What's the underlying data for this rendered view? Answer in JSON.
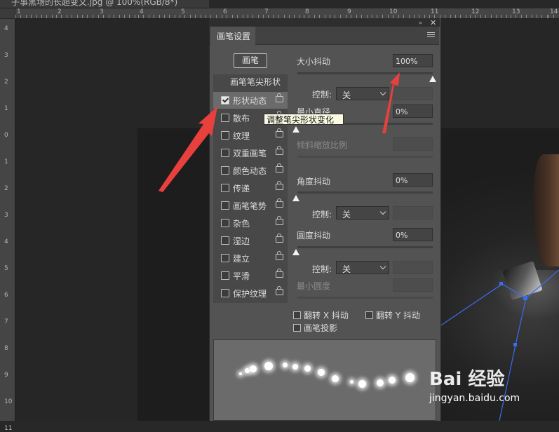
{
  "document_tab": {
    "title": "子事黑场的长超变文.jpg @ 100%(RGB/8*)"
  },
  "ruler": {
    "top_labels": [
      "1",
      "2",
      "3",
      "4",
      "5",
      "6",
      "7",
      "8",
      "9",
      "10",
      "11",
      "12",
      "13",
      "14"
    ],
    "left_labels": [
      "4",
      "3",
      "2",
      "1",
      "0",
      "1",
      "2",
      "3",
      "4",
      "5",
      "6",
      "7",
      "8",
      "9",
      "10",
      "11"
    ]
  },
  "panel": {
    "title": "画笔设置",
    "brush_button": "画笔",
    "tip_shape_label": "画笔笔尖形状",
    "categories": [
      {
        "label": "形状动态",
        "checked": true,
        "selected": true
      },
      {
        "label": "散布",
        "checked": false
      },
      {
        "label": "纹理",
        "checked": false
      },
      {
        "label": "双重画笔",
        "checked": false
      },
      {
        "label": "颜色动态",
        "checked": false
      },
      {
        "label": "传递",
        "checked": false
      },
      {
        "label": "画笔笔势",
        "checked": false
      },
      {
        "label": "杂色",
        "checked": false
      },
      {
        "label": "湿边",
        "checked": false
      },
      {
        "label": "建立",
        "checked": false
      },
      {
        "label": "平滑",
        "checked": false
      },
      {
        "label": "保护纹理",
        "checked": false
      }
    ],
    "size_jitter": {
      "label": "大小抖动",
      "value": "100%",
      "level": 1.0
    },
    "control_1": {
      "label": "控制:",
      "value": "关"
    },
    "min_diameter": {
      "label": "最小直径",
      "value": "0%",
      "level": 0.0
    },
    "tilt_scale": {
      "label": "倾斜缩放比例"
    },
    "angle_jitter": {
      "label": "角度抖动",
      "value": "0%",
      "level": 0.0
    },
    "control_2": {
      "label": "控制:",
      "value": "关"
    },
    "roundness_jitter": {
      "label": "圆度抖动",
      "value": "0%",
      "level": 0.0
    },
    "control_3": {
      "label": "控制:",
      "value": "关"
    },
    "min_roundness": {
      "label": "最小圆度"
    },
    "flip_x": {
      "label": "翻转 X 抖动",
      "checked": false
    },
    "flip_y": {
      "label": "翻转 Y 抖动",
      "checked": false
    },
    "brush_projection": {
      "label": "画笔投影",
      "checked": false
    }
  },
  "tooltip": "调整笔尖形状变化",
  "watermark": {
    "logo": "Bai 经验",
    "url": "jingyan.baidu.com"
  },
  "colors": {
    "panel_bg": "#535353",
    "selected_row": "#6b6b6b",
    "annotation_arrow": "#e8403c",
    "path": "#3a6cf0"
  }
}
